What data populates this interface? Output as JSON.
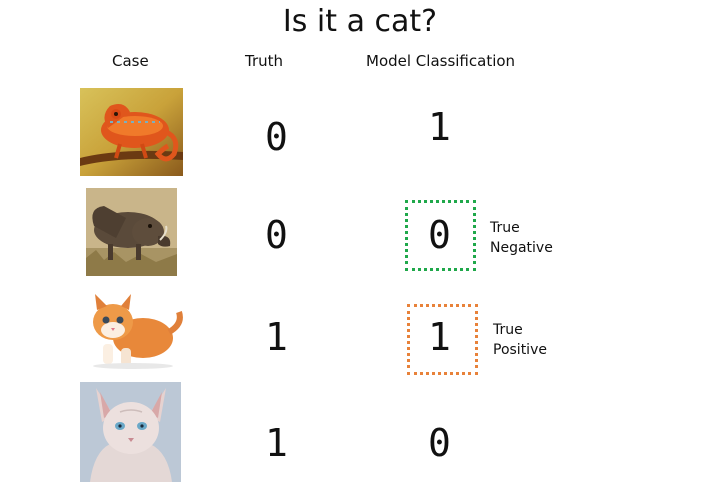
{
  "title": "Is it a cat?",
  "headers": {
    "case": "Case",
    "truth": "Truth",
    "model": "Model Classification"
  },
  "rows": [
    {
      "image": "chameleon",
      "truth": "0",
      "prediction": "1",
      "annotation": []
    },
    {
      "image": "warthog",
      "truth": "0",
      "prediction": "0",
      "annotation": [
        "True",
        "Negative"
      ],
      "box_color": "#1fa84a"
    },
    {
      "image": "kitten",
      "truth": "1",
      "prediction": "1",
      "annotation": [
        "True",
        "Positive"
      ],
      "box_color": "#e8823a"
    },
    {
      "image": "sphynx-cat",
      "truth": "1",
      "prediction": "0",
      "annotation": []
    }
  ],
  "colors": {
    "true_negative": "#1fa84a",
    "true_positive": "#e8823a"
  }
}
